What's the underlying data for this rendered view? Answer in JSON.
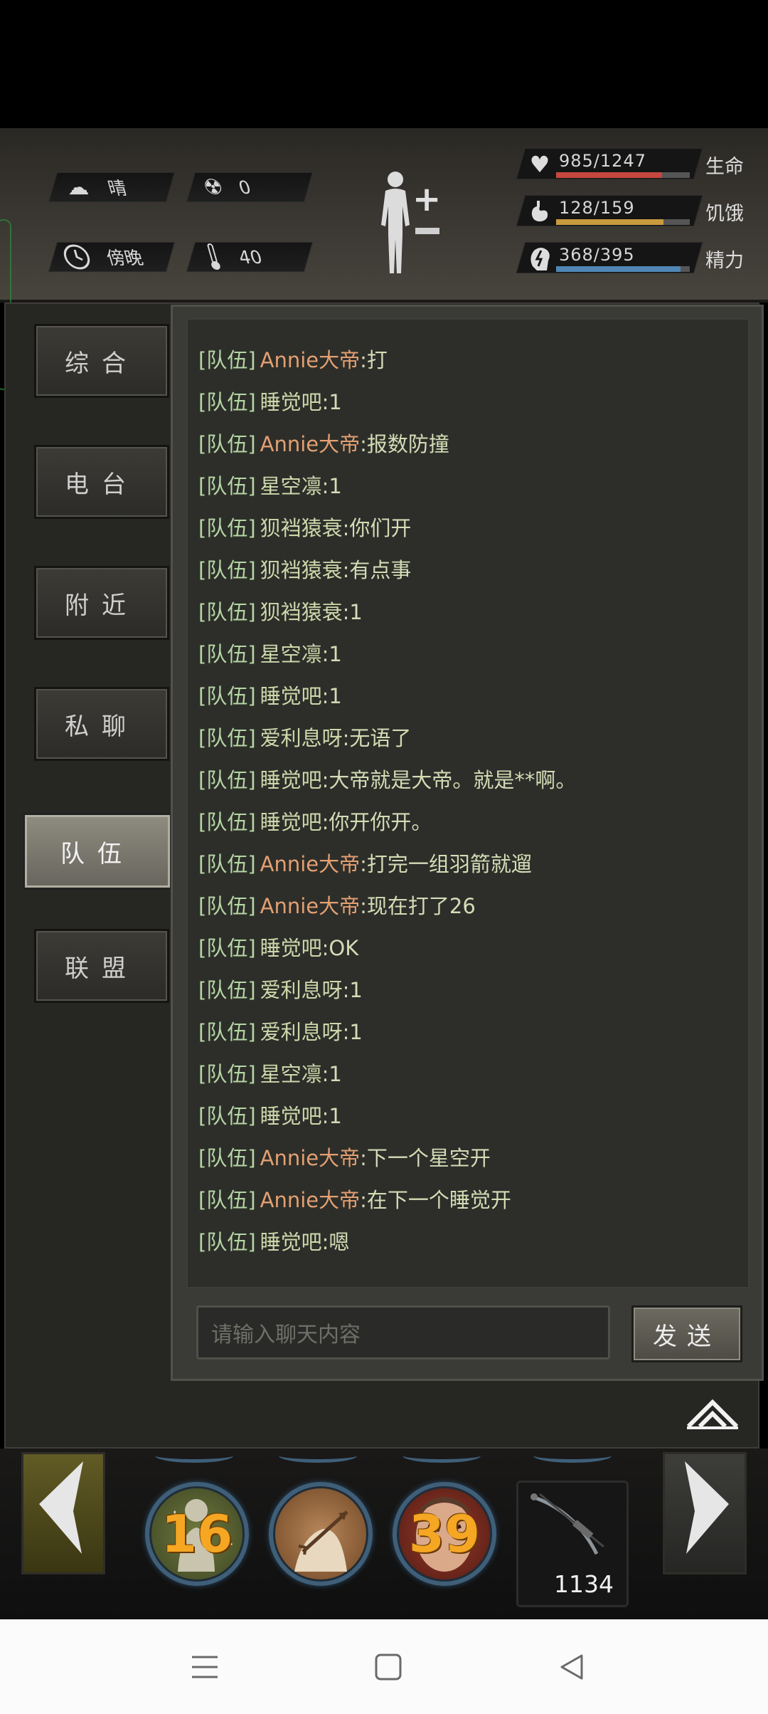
{
  "header": {
    "weather": {
      "icon": "cloud-sun-icon",
      "label": "晴"
    },
    "radiation": {
      "icon": "radiation-icon",
      "value": "0"
    },
    "time": {
      "icon": "clock-icon",
      "label": "傍晚"
    },
    "temperature": {
      "icon": "thermometer-icon",
      "value": "40"
    },
    "stats": [
      {
        "key": "health",
        "icon": "heart-pulse-icon",
        "value": "985/1247",
        "current": 985,
        "max": 1247,
        "label": "生命",
        "color": "#c6473f"
      },
      {
        "key": "hunger",
        "icon": "stomach-icon",
        "value": "128/159",
        "current": 128,
        "max": 159,
        "label": "饥饿",
        "color": "#c99a3e"
      },
      {
        "key": "energy",
        "icon": "brain-bolt-icon",
        "value": "368/395",
        "current": 368,
        "max": 395,
        "label": "精力",
        "color": "#4f86b4"
      }
    ]
  },
  "tabs": [
    {
      "label": "综合",
      "active": false
    },
    {
      "label": "电台",
      "active": false
    },
    {
      "label": "附近",
      "active": false
    },
    {
      "label": "私聊",
      "active": false
    },
    {
      "label": "队伍",
      "active": true
    },
    {
      "label": "联盟",
      "active": false
    }
  ],
  "chat": {
    "messages": [
      {
        "channel": "[队伍]",
        "sender": "Annie大帝",
        "vip": true,
        "text": ":打"
      },
      {
        "channel": "[队伍]",
        "sender": "睡觉吧",
        "vip": false,
        "text": ":1"
      },
      {
        "channel": "[队伍]",
        "sender": "Annie大帝",
        "vip": true,
        "text": ":报数防撞"
      },
      {
        "channel": "[队伍]",
        "sender": "星空凛",
        "vip": false,
        "text": ":1"
      },
      {
        "channel": "[队伍]",
        "sender": "狈裆猿衰",
        "vip": false,
        "text": ":你们开"
      },
      {
        "channel": "[队伍]",
        "sender": "狈裆猿衰",
        "vip": false,
        "text": ":有点事"
      },
      {
        "channel": "[队伍]",
        "sender": "狈裆猿衰",
        "vip": false,
        "text": ":1"
      },
      {
        "channel": "[队伍]",
        "sender": "星空凛",
        "vip": false,
        "text": ":1"
      },
      {
        "channel": "[队伍]",
        "sender": "睡觉吧",
        "vip": false,
        "text": ":1"
      },
      {
        "channel": "[队伍]",
        "sender": "爱利息呀",
        "vip": false,
        "text": ":无语了"
      },
      {
        "channel": "[队伍]",
        "sender": "睡觉吧",
        "vip": false,
        "text": ":大帝就是大帝。就是**啊。"
      },
      {
        "channel": "[队伍]",
        "sender": "睡觉吧",
        "vip": false,
        "text": ":你开你开。"
      },
      {
        "channel": "[队伍]",
        "sender": "Annie大帝",
        "vip": true,
        "text": ":打完一组羽箭就遛"
      },
      {
        "channel": "[队伍]",
        "sender": "Annie大帝",
        "vip": true,
        "text": ":现在打了26"
      },
      {
        "channel": "[队伍]",
        "sender": "睡觉吧",
        "vip": false,
        "text": ":OK"
      },
      {
        "channel": "[队伍]",
        "sender": "爱利息呀",
        "vip": false,
        "text": ":1"
      },
      {
        "channel": "[队伍]",
        "sender": "爱利息呀",
        "vip": false,
        "text": ":1"
      },
      {
        "channel": "[队伍]",
        "sender": "星空凛",
        "vip": false,
        "text": ":1"
      },
      {
        "channel": "[队伍]",
        "sender": "睡觉吧",
        "vip": false,
        "text": ":1"
      },
      {
        "channel": "[队伍]",
        "sender": "Annie大帝",
        "vip": true,
        "text": ":下一个星空开"
      },
      {
        "channel": "[队伍]",
        "sender": "Annie大帝",
        "vip": true,
        "text": ":在下一个睡觉开"
      },
      {
        "channel": "[队伍]",
        "sender": "睡觉吧",
        "vip": false,
        "text": ":嗯"
      }
    ],
    "input_placeholder": "请输入聊天内容",
    "send_label": "发送"
  },
  "actionbar": {
    "skills": [
      {
        "icon": "heal-figure-icon",
        "count": "16"
      },
      {
        "icon": "arrow-wound-icon",
        "count": ""
      },
      {
        "icon": "angry-face-icon",
        "count": "39"
      }
    ],
    "equipped": {
      "icon": "crossbow-icon",
      "count": "1134"
    }
  },
  "navbar": {
    "items": [
      "menu-icon",
      "home-square-icon",
      "back-triangle-icon"
    ]
  }
}
